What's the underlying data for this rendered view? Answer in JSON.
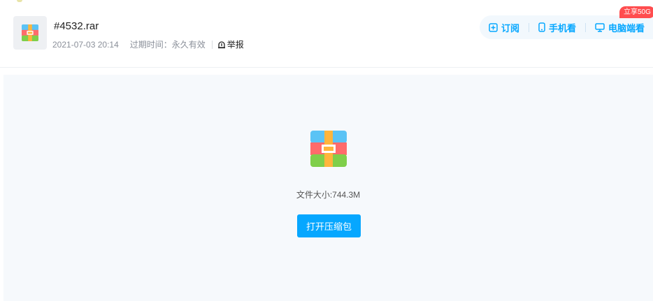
{
  "file": {
    "name": "#4532.rar",
    "date": "2021-07-03 20:14",
    "expire_label": "过期时间：永久有效",
    "report_label": "举报",
    "icon": "rar-archive-icon"
  },
  "actions": {
    "subscribe_label": "订阅",
    "phone_label": "手机看",
    "pc_label": "电脑端看",
    "badge": "立享50G"
  },
  "main": {
    "size_text": "文件大小:744.3M",
    "open_button": "打开压缩包"
  },
  "colors": {
    "accent": "#06a7ff",
    "badge": "#ff4d4f",
    "panel_bg": "#f6f9fc"
  }
}
